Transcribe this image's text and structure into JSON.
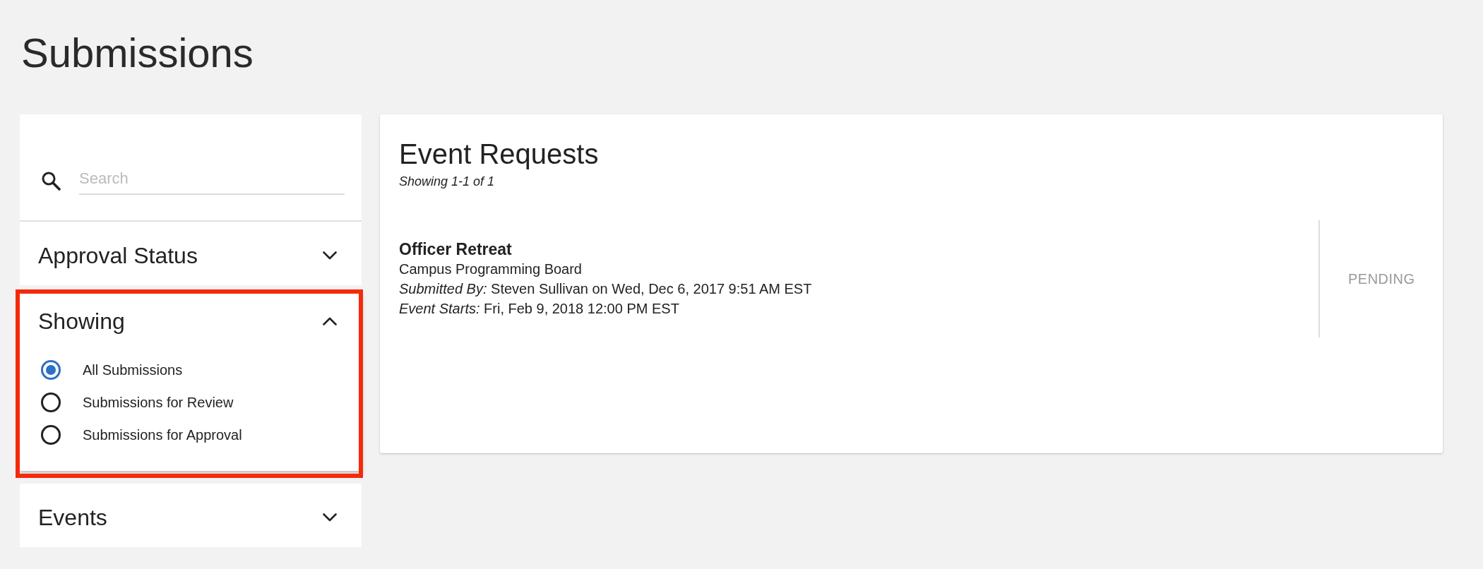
{
  "page": {
    "title": "Submissions"
  },
  "filters": {
    "search": {
      "placeholder": "Search"
    },
    "sections": [
      {
        "title": "Approval Status",
        "expanded": false,
        "highlighted": false
      },
      {
        "title": "Showing",
        "expanded": true,
        "highlighted": true,
        "options": [
          {
            "label": "All Submissions",
            "selected": true
          },
          {
            "label": "Submissions for Review",
            "selected": false
          },
          {
            "label": "Submissions for Approval",
            "selected": false
          }
        ]
      },
      {
        "title": "Events",
        "expanded": false,
        "highlighted": false
      }
    ]
  },
  "results": {
    "title": "Event Requests",
    "count": "Showing 1-1 of 1",
    "items": [
      {
        "name": "Officer Retreat",
        "organization": "Campus Programming Board",
        "submitted": "*Submitted By:* Steven Sullivan on Wed, Dec 6, 2017 9:51 AM EST",
        "starts": "*Event Starts:* Fri, Feb 9, 2018 12:00 PM EST",
        "status": "PENDING"
      }
    ]
  }
}
